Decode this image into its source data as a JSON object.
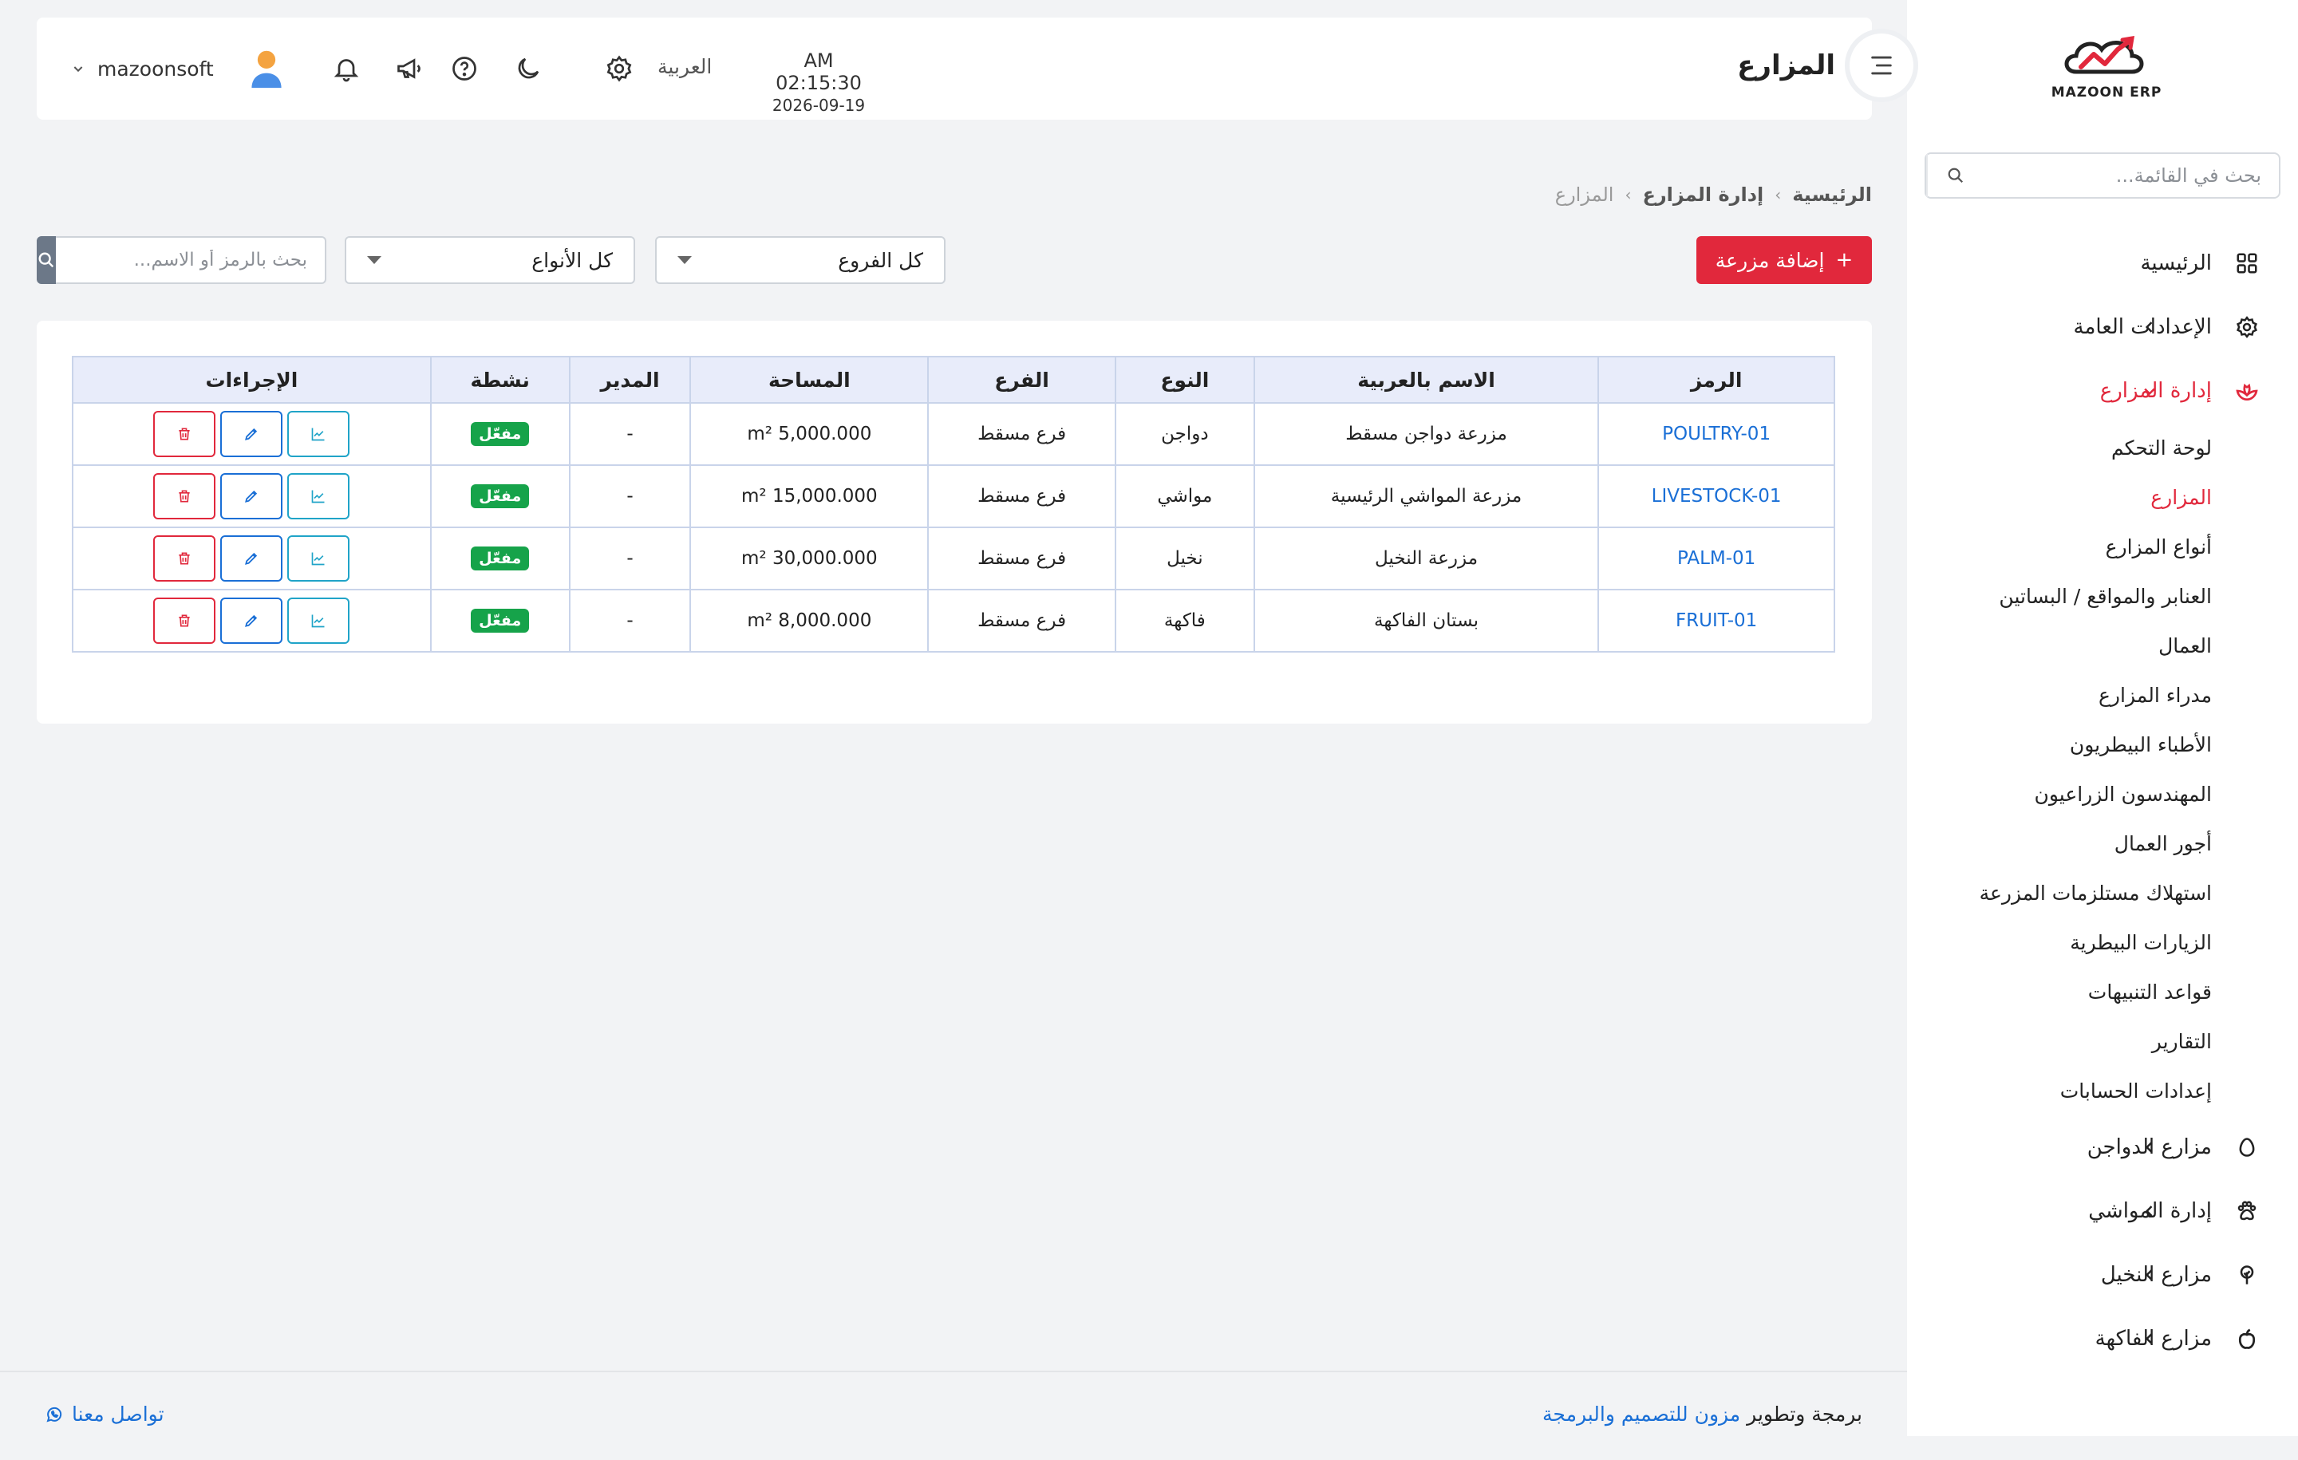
{
  "sidebar": {
    "logo_text": "MAZOON ERP",
    "search_placeholder": "بحث في القائمة...",
    "menu": {
      "home": "الرئيسية",
      "general_settings": "الإعدادات العامة",
      "farm_management": "إدارة المزارع",
      "poultry_farms": "مزارع الدواجن",
      "livestock_management": "إدارة المواشي",
      "palm_farms": "مزارع النخيل",
      "fruit_farms": "مزارع الفاكهة"
    },
    "submenu": [
      "لوحة التحكم",
      "المزارع",
      "أنواع المزارع",
      "العنابر والمواقع / البساتين",
      "العمال",
      "مدراء المزارع",
      "الأطباء البيطريون",
      "المهندسون الزراعيون",
      "أجور العمال",
      "استهلاك مستلزمات المزرعة",
      "الزيارات البيطرية",
      "قواعد التنبيهات",
      "التقارير",
      "إعدادات الحسابات"
    ],
    "active_submenu_index": 1
  },
  "header": {
    "title": "المزارع",
    "time": "AM 02:15:30",
    "date": "2026-09-19",
    "language": "العربية",
    "username": "mazoonsoft"
  },
  "breadcrumb": {
    "home": "الرئيسية",
    "section": "إدارة المزارع",
    "current": "المزارع",
    "separator": "›"
  },
  "filters": {
    "add_label": "إضافة مزرعة",
    "add_icon": "+",
    "branches_value": "كل الفروع",
    "types_value": "كل الأنواع",
    "search_placeholder": "بحث بالرمز أو الاسم..."
  },
  "table": {
    "headers": {
      "code": "الرمز",
      "name": "الاسم بالعربية",
      "type": "النوع",
      "branch": "الفرع",
      "area": "المساحة",
      "manager": "المدير",
      "active": "نشطة",
      "actions": "الإجراءات"
    },
    "rows": [
      {
        "code": "POULTRY-01",
        "name": "مزرعة دواجن مسقط",
        "type": "دواجن",
        "branch": "فرع مسقط",
        "area": "5,000.000 m²",
        "manager": "-",
        "status": "مفعّل"
      },
      {
        "code": "LIVESTOCK-01",
        "name": "مزرعة المواشي الرئيسية",
        "type": "مواشي",
        "branch": "فرع مسقط",
        "area": "15,000.000 m²",
        "manager": "-",
        "status": "مفعّل"
      },
      {
        "code": "PALM-01",
        "name": "مزرعة النخيل",
        "type": "نخيل",
        "branch": "فرع مسقط",
        "area": "30,000.000 m²",
        "manager": "-",
        "status": "مفعّل"
      },
      {
        "code": "FRUIT-01",
        "name": "بستان الفاكهة",
        "type": "فاكهة",
        "branch": "فرع مسقط",
        "area": "8,000.000 m²",
        "manager": "-",
        "status": "مفعّل"
      }
    ]
  },
  "footer": {
    "credit_prefix": "برمجة وتطوير",
    "credit_link": "مزون للتصميم والبرمجة",
    "contact": "تواصل معنا"
  },
  "colors": {
    "accent": "#e1283c",
    "link": "#1a6fd6",
    "success": "#16a34a",
    "table_header": "#e8ecfa"
  }
}
